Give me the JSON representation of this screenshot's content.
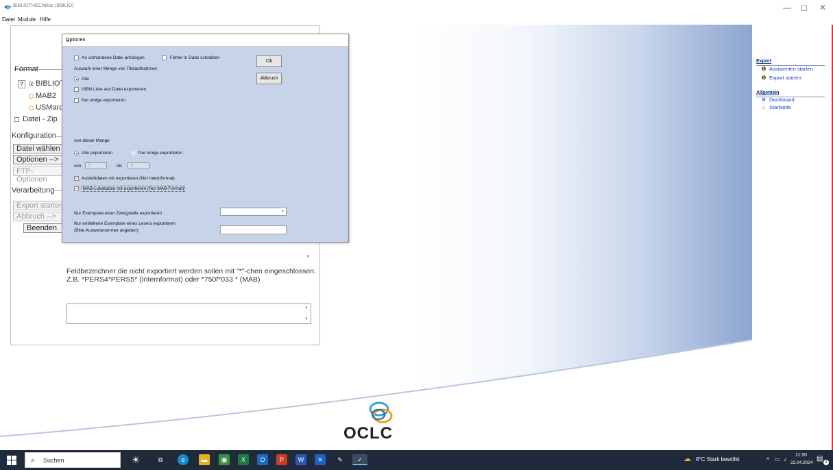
{
  "window": {
    "title": "BIBLIOTHECAplus (BIBLIO)",
    "minimize": "—",
    "maximize": "◻",
    "close": "✕"
  },
  "menu": [
    "Datei",
    "Module",
    "Hilfe"
  ],
  "form": {
    "format_label": "Format",
    "help": "?",
    "format_options": [
      "BIBLIOTH",
      "MAB2",
      "USMarc"
    ],
    "zip_label": "Datei - Zip",
    "konfig_label": "Konfiguration",
    "datei_waehlen": "Datei wählen",
    "optionen": "Optionen -->",
    "ftp_optionen": "FTP-Optionen",
    "verarbeitung_label": "Verarbeitung",
    "export_starten": "Export starten",
    "abbruch": "Abbruch -->",
    "beenden": "Beenden",
    "field_hint_line1": "Feldbezeichner die nicht exportiert werden sollen mit \"*\"-chen eingeschlossen.",
    "field_hint_line2": "Z.B. *PERS4*PERS5* (Internformat) oder *750f*033 * (MAB)"
  },
  "dialog": {
    "title": "Optionen",
    "close": "✕",
    "append_label": "An vorhandene Datei anhängen",
    "errors_label": "Fehler in Datei schreiben",
    "ok": "Ok",
    "cancel": "Abbruch",
    "selection_heading": "Auswahl einer Menge von Titelaufnahmen",
    "opt_alle": "Alle",
    "opt_isbn": "ISBN Liste aus Datei exportieren",
    "opt_einige": "Nur einige exportieren",
    "von_dieser_menge": "von dieser Menge",
    "alle_exportieren": "Alle exportieren",
    "nur_einige_exportieren": "Nur einige exportieren",
    "von": "von",
    "von_value": "0",
    "bis": "bis",
    "bis_value": "0",
    "ausleihdaten": "Ausleihdaten mit exportieren (Nur Internformat)",
    "mab_lokal": "MAB-Lokalsätze mit exportieren (Nur MAB-Format)",
    "zweigstelle_label": "Nur Exemplare einer Zweigstelle exportieren",
    "entliehen_label_1": "Nur entliehene Exemplare eines Lesers exportieren",
    "entliehen_label_2": "(Bitte Ausweisnummer angeben)"
  },
  "right_panel": {
    "export_heading": "Export",
    "assistenten": "Assistenten starten",
    "export_starten": "Export starten",
    "allgemein_heading": "Allgemein",
    "dashboard": "Dashboard",
    "startseite": "Startseite"
  },
  "logo_text": "OCLC",
  "taskbar": {
    "search": "Suchen",
    "weather": "8°C  Stark bewölkt",
    "time": "11:50",
    "date": "22.04.2024",
    "notif_count": "2"
  }
}
